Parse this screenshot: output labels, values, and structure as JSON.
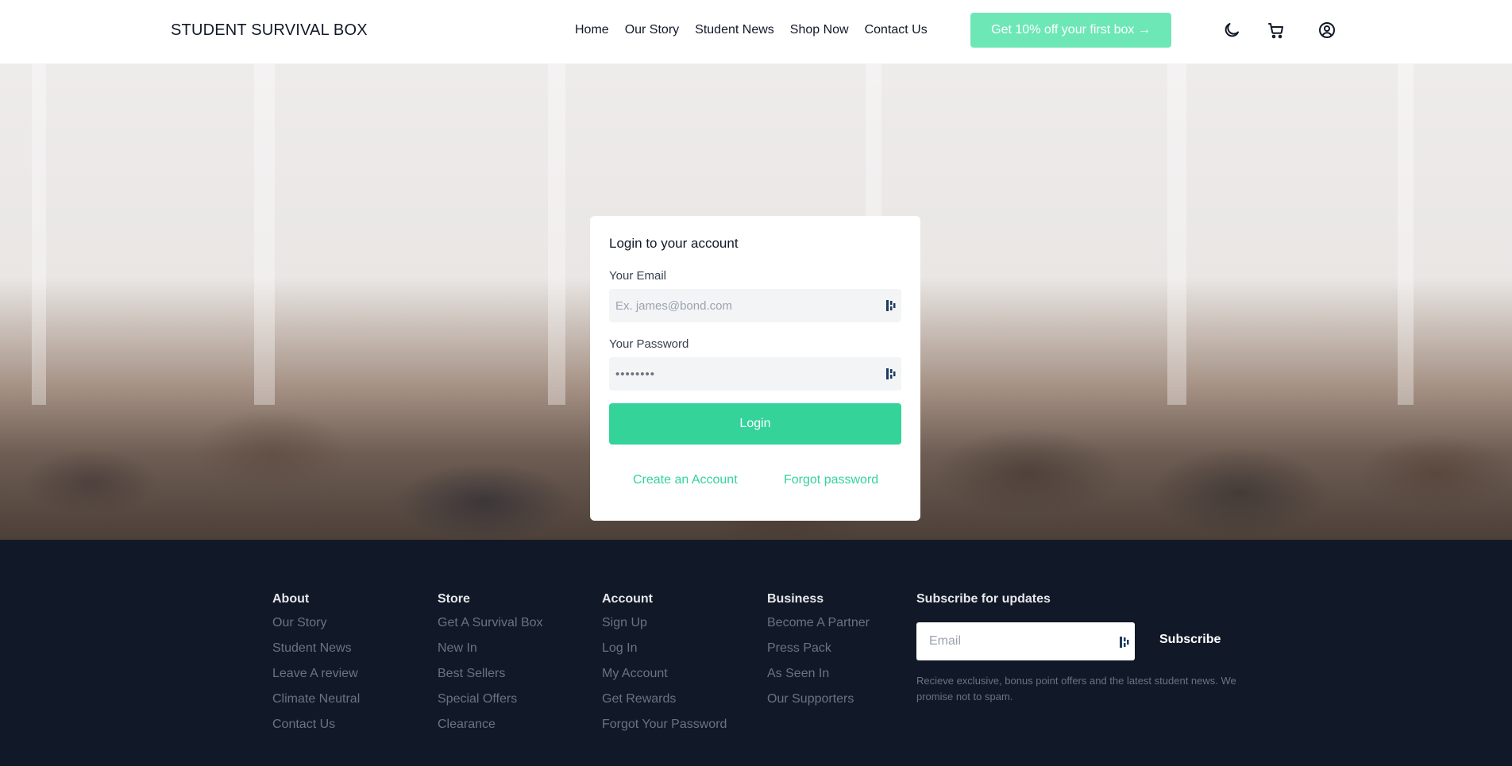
{
  "header": {
    "brand": "STUDENT SURVIVAL BOX",
    "nav": [
      "Home",
      "Our Story",
      "Student News",
      "Shop Now",
      "Contact Us"
    ],
    "promo_label": "Get 10% off your first box →",
    "icons": [
      "moon-icon",
      "cart-icon",
      "user-circle-icon"
    ]
  },
  "login": {
    "title": "Login to your account",
    "email_label": "Your Email",
    "email_placeholder": "Ex. james@bond.com",
    "password_label": "Your Password",
    "password_value": "••••••••",
    "button": "Login",
    "create_account": "Create an Account",
    "forgot_password": "Forgot password"
  },
  "footer": {
    "columns": [
      {
        "heading": "About",
        "items": [
          "Our Story",
          "Student News",
          "Leave A review",
          "Climate Neutral",
          "Contact Us"
        ]
      },
      {
        "heading": "Store",
        "items": [
          "Get A Survival Box",
          "New In",
          "Best Sellers",
          "Special Offers",
          "Clearance"
        ]
      },
      {
        "heading": "Account",
        "items": [
          "Sign Up",
          "Log In",
          "My Account",
          "Get Rewards",
          "Forgot Your Password"
        ]
      },
      {
        "heading": "Business",
        "items": [
          "Become A Partner",
          "Press Pack",
          "As Seen In",
          "Our Supporters"
        ]
      }
    ],
    "subscribe": {
      "heading": "Subscribe for updates",
      "placeholder": "Email",
      "button": "Subscribe",
      "note": "Recieve exclusive, bonus point offers and the latest student news. We promise not to spam."
    }
  },
  "colors": {
    "accent": "#34d399",
    "promo": "#6ee7b7",
    "footer_bg": "#111827"
  }
}
